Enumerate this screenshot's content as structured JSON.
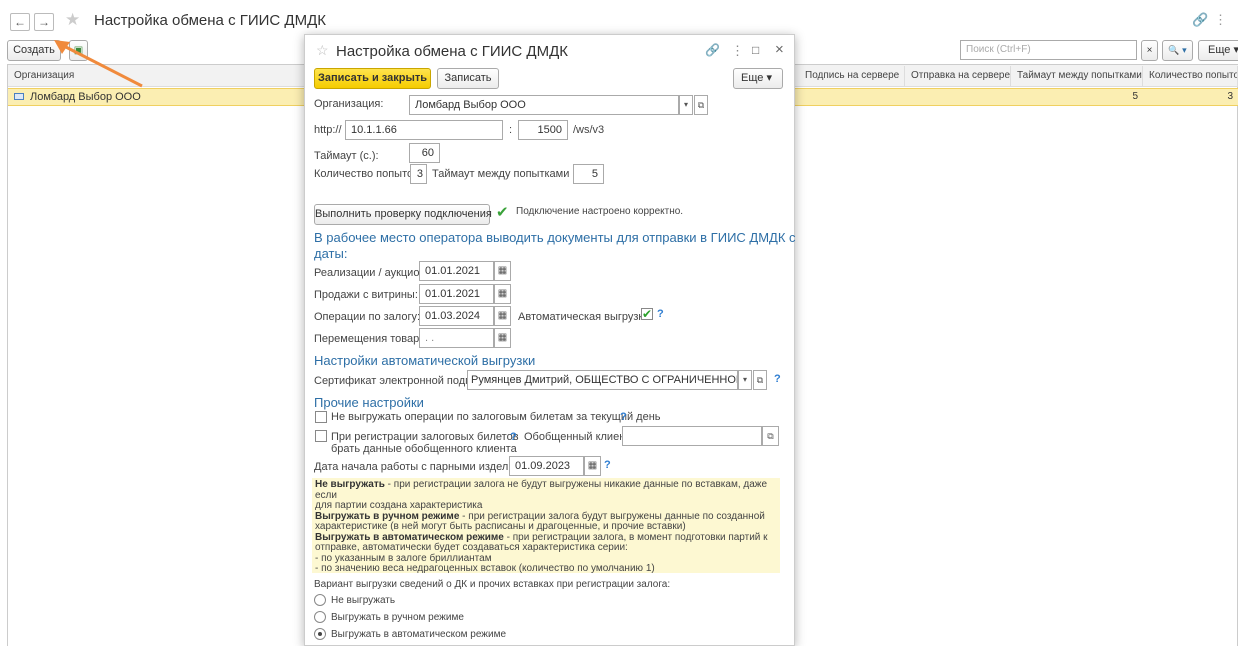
{
  "window": {
    "title": "Настройка обмена с ГИИС ДМДК",
    "back": "←",
    "forward": "→",
    "star": "★",
    "link": "🔗",
    "menu": "⋮"
  },
  "toolbar": {
    "create_label": "Создать",
    "search_placeholder": "Поиск (Ctrl+F)",
    "clear": "×",
    "search_btn": "🔍 ▾",
    "more_label": "Еще"
  },
  "list": {
    "columns": [
      "Организация",
      "Подпись на сервере",
      "Отправка на сервере",
      "Таймаут между попытками",
      "Количество попыток"
    ],
    "row": {
      "org": "Ломбард Выбор ООО",
      "timeout": "5",
      "attempts": "3"
    }
  },
  "accent": "#f5cc00",
  "arrow_color": "#f08a3c",
  "dialog": {
    "title": "Настройка обмена с ГИИС ДМДК",
    "star": "☆",
    "link": "🔗",
    "menu": "⋮",
    "minimize": "□",
    "close": "×",
    "save_close": "Записать и закрыть",
    "save": "Записать",
    "more": "Еще",
    "org_label": "Организация:",
    "org_value": "Ломбард Выбор ООО",
    "http_label": "http://",
    "host": "10.1.1.66",
    "colon": ":",
    "port": "1500",
    "path": "/ws/v3",
    "timeout_label": "Таймаут (с.):",
    "timeout": "60",
    "attempts_label": "Количество попыток:",
    "attempts": "3",
    "between_label": "Таймаут между попытками (с.):",
    "between": "5",
    "check_btn": "Выполнить проверку подключения",
    "check_status": "Подключение настроено корректно.",
    "section1": "В рабочее место оператора выводить документы для отправки в ГИИС ДМДК с",
    "section1b": "даты:",
    "sales_label": "Реализации / аукцион:",
    "sales_date": "01.01.2021",
    "showcase_label": "Продажи с витрины:",
    "showcase_date": "01.01.2021",
    "pledge_label": "Операции по залогу:",
    "pledge_date": "01.03.2024",
    "auto_upload_label": "Автоматическая выгрузка:",
    "moves_label": "Перемещения товаров:",
    "moves_date": " .  .",
    "section2": "Настройки автоматической выгрузки",
    "cert_label": "Сертификат электронной подписи:",
    "cert_value": "Румянцев Дмитрий, ОБЩЕСТВО С ОГРАНИЧЕННОЙ ОТВЕ",
    "section3": "Прочие настройки",
    "opt1": "Не выгружать операции по залоговым билетам за текущий день",
    "opt2a": "При регистрации залоговых билетов",
    "opt2b": "брать данные обобщенного клиента",
    "generic_client_label": "Обобщенный клиент:",
    "pairs_label": "Дата начала работы с парными изделиями:",
    "pairs_date": "01.09.2023",
    "q": "?",
    "hint": {
      "b1": "Не выгружать",
      "t1": " - при регистрации залога не будут выгружены никакие данные по вставкам, даже если",
      "t1b": "для партии создана характеристика",
      "b2": "Выгружать в ручном режиме",
      "t2": " - при регистрации залога будут выгружены данные по созданной",
      "t2b": "характеристике (в ней могут быть расписаны и драгоценные, и прочие вставки)",
      "b3": "Выгружать в автоматическом режиме",
      "t3": " - при регистрации залога, в момент подготовки партий к",
      "t3b": "отправке, автоматически будет создаваться характеристика серии:",
      "t4": "- по указанным в залоге бриллиантам",
      "t5": "- по значению веса недрагоценных вставок (количество по умолчанию 1)"
    },
    "variant_label": "Вариант выгрузки сведений о ДК и прочих вставках при регистрации залога:",
    "radio1": "Не выгружать",
    "radio2": "Выгружать в ручном режиме",
    "radio3": "Выгружать в автоматическом режиме"
  }
}
